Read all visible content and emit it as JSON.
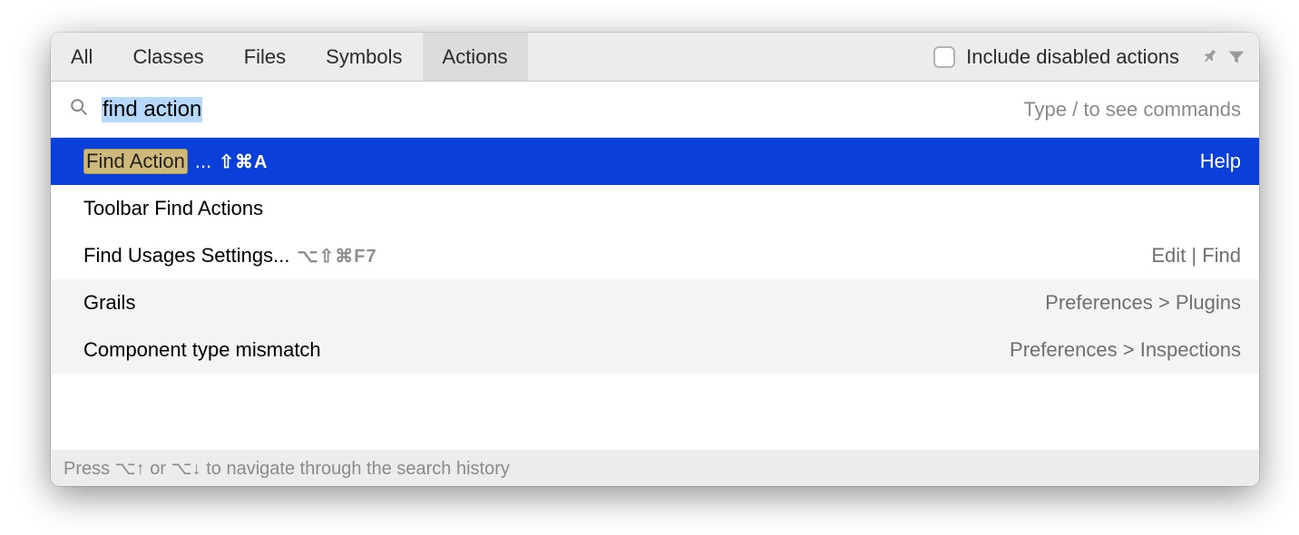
{
  "tabs": {
    "all": "All",
    "classes": "Classes",
    "files": "Files",
    "symbols": "Symbols",
    "actions": "Actions"
  },
  "include_disabled_label": "Include disabled actions",
  "search": {
    "value": "find action",
    "hint": "Type / to see commands"
  },
  "results": [
    {
      "match": "Find Action",
      "suffix": "...",
      "shortcut": "⇧⌘A",
      "right": "Help",
      "selected": true
    },
    {
      "label": "Toolbar Find Actions",
      "right": ""
    },
    {
      "label": "Find Usages Settings...",
      "shortcut": "⌥⇧⌘F7",
      "shortcut_dim": true,
      "right": "Edit | Find"
    },
    {
      "label": "Grails",
      "right": "Preferences > Plugins",
      "disabled_bg": true
    },
    {
      "label": "Component type mismatch",
      "right": "Preferences > Inspections",
      "disabled_bg": true
    }
  ],
  "footer": "Press ⌥↑ or ⌥↓ to navigate through the search history"
}
